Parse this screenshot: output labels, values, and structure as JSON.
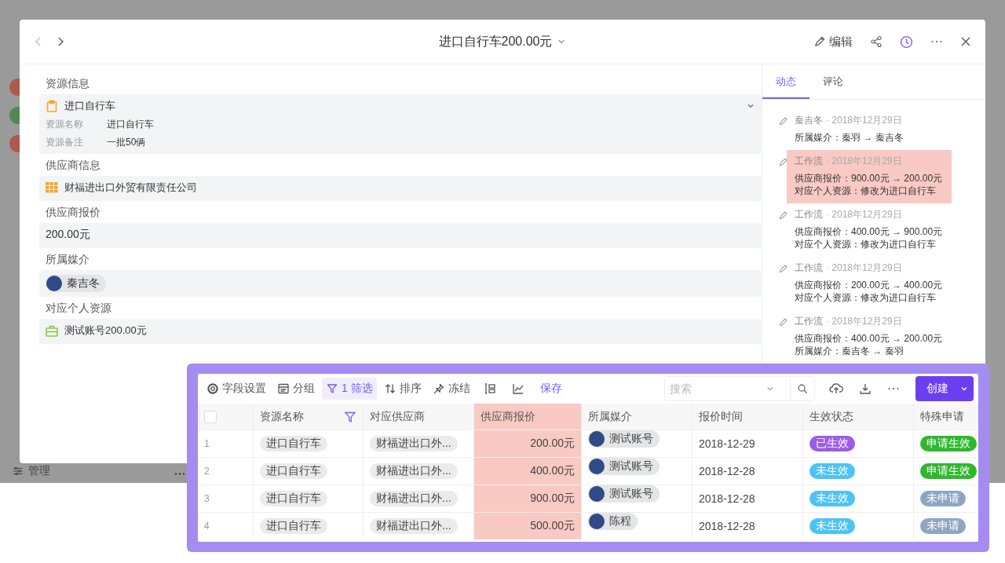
{
  "background_app": {
    "footer_label": "管理"
  },
  "modal": {
    "title": "进口自行车200.00元",
    "edit_label": "编辑",
    "sections": [
      {
        "label": "资源信息",
        "kind": "record",
        "text": "进口自行车",
        "fields": [
          {
            "name": "资源名称",
            "value": "进口自行车"
          },
          {
            "name": "资源备注",
            "value": "一批50俩"
          }
        ]
      },
      {
        "label": "供应商信息",
        "kind": "company",
        "text": "财福进出口外贸有限责任公司"
      },
      {
        "label": "供应商报价",
        "kind": "price",
        "text": "200.00元"
      },
      {
        "label": "所属媒介",
        "kind": "member",
        "text": "秦吉冬"
      },
      {
        "label": "对应个人资源",
        "kind": "account",
        "text": "测试账号200.00元"
      }
    ],
    "tabs": [
      {
        "label": "动态",
        "selected": true
      },
      {
        "label": "评论",
        "selected": false
      }
    ],
    "activity": [
      {
        "author": "秦吉冬",
        "date": "· 2018年12月29日",
        "highlighted": false,
        "lines": [
          "所属媒介：秦羽 → 秦吉冬"
        ]
      },
      {
        "author": "工作流",
        "date": "· 2018年12月29日",
        "highlighted": true,
        "lines": [
          "供应商报价：900.00元 → 200.00元",
          "对应个人资源：修改为进口自行车"
        ]
      },
      {
        "author": "工作流",
        "date": "· 2018年12月29日",
        "highlighted": false,
        "lines": [
          "供应商报价：400.00元 → 900.00元",
          "对应个人资源：修改为进口自行车"
        ]
      },
      {
        "author": "工作流",
        "date": "· 2018年12月29日",
        "highlighted": false,
        "lines": [
          "供应商报价：200.00元 → 400.00元",
          "对应个人资源：修改为进口自行车"
        ]
      },
      {
        "author": "工作流",
        "date": "· 2018年12月29日",
        "highlighted": false,
        "lines": [
          "供应商报价：400.00元 → 200.00元",
          "所属媒介：秦吉冬 → 秦羽"
        ]
      }
    ]
  },
  "view": {
    "toolbar": [
      {
        "label": "字段设置",
        "kind": "fields",
        "selected": false
      },
      {
        "label": "分组",
        "kind": "group",
        "selected": false
      },
      {
        "label": "1 筛选",
        "kind": "filter",
        "selected": true
      },
      {
        "label": "排序",
        "kind": "sort",
        "selected": false
      },
      {
        "label": "冻结",
        "kind": "pin",
        "selected": false
      }
    ],
    "save_label": "保存",
    "search": {
      "placeholder": "搜索"
    },
    "create_label": "创建",
    "table": {
      "select_all": {
        "checked": false
      },
      "columns": [
        {
          "label": "资源名称",
          "filtered": true,
          "highlighted": false
        },
        {
          "label": "对应供应商",
          "filtered": false,
          "highlighted": false
        },
        {
          "label": "供应商报价",
          "filtered": false,
          "highlighted": true
        },
        {
          "label": "所属媒介",
          "filtered": false,
          "highlighted": false
        },
        {
          "label": "报价时间",
          "filtered": false,
          "highlighted": false
        },
        {
          "label": "生效状态",
          "filtered": false,
          "highlighted": false
        },
        {
          "label": "特殊申请",
          "filtered": false,
          "highlighted": false
        }
      ],
      "rows": [
        {
          "index": "1",
          "name": "进口自行车",
          "supplier": "财福进出口外...",
          "price": "200.00元",
          "media": "测试账号",
          "time": "2018-12-29",
          "status": {
            "label": "已生效",
            "color": "#9b5de5"
          },
          "special": {
            "label": "申请生效",
            "color": "#2eb82e"
          }
        },
        {
          "index": "2",
          "name": "进口自行车",
          "supplier": "财福进出口外...",
          "price": "400.00元",
          "media": "测试账号",
          "time": "2018-12-28",
          "status": {
            "label": "未生效",
            "color": "#4cc3f5"
          },
          "special": {
            "label": "申请生效",
            "color": "#2eb82e"
          }
        },
        {
          "index": "3",
          "name": "进口自行车",
          "supplier": "财福进出口外...",
          "price": "900.00元",
          "media": "测试账号",
          "time": "2018-12-28",
          "status": {
            "label": "未生效",
            "color": "#4cc3f5"
          },
          "special": {
            "label": "未申请",
            "color": "#8fa6c2"
          }
        },
        {
          "index": "4",
          "name": "进口自行车",
          "supplier": "财福进出口外...",
          "price": "500.00元",
          "media": "陈程",
          "time": "2018-12-28",
          "status": {
            "label": "未生效",
            "color": "#4cc3f5"
          },
          "special": {
            "label": "未申请",
            "color": "#8fa6c2"
          }
        }
      ]
    }
  }
}
